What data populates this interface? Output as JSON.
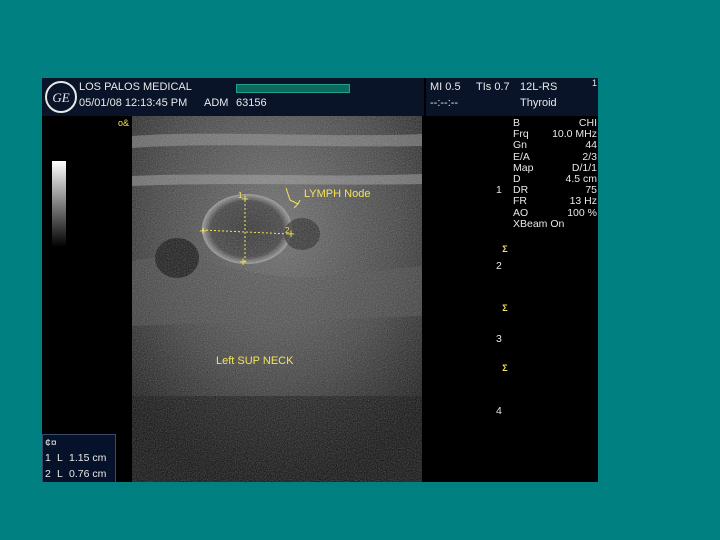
{
  "header": {
    "facility": "LOS PALOS MEDICAL",
    "datetime": "05/01/08 12:13:45 PM",
    "operator": "ADM",
    "patient_id": "63156",
    "mi": "MI 0.5",
    "tis": "TIs 0.7",
    "probe": "12L-RS",
    "preset": "Thyroid",
    "clock": "--:--:--",
    "frame_marker": "1",
    "logo_icon": "ge-logo-icon"
  },
  "annotations": {
    "lymph_node": "LYMPH Node",
    "region": "Left SUP NECK",
    "orientation_mark": "o&",
    "caliper1_label": "1",
    "caliper2_label": "2"
  },
  "params": [
    {
      "k": "B",
      "v": "CHI"
    },
    {
      "k": "Frq",
      "v": "10.0 MHz"
    },
    {
      "k": "Gn",
      "v": "44"
    },
    {
      "k": "E/A",
      "v": "2/3"
    },
    {
      "k": "Map",
      "v": "D/1/1"
    },
    {
      "k": "D",
      "v": "4.5 cm"
    },
    {
      "k": "DR",
      "v": "75"
    },
    {
      "k": "FR",
      "v": "13 Hz"
    },
    {
      "k": "AO",
      "v": "100 %"
    },
    {
      "k": "XBeam On",
      "v": ""
    }
  ],
  "depth_scale": [
    "1",
    "2",
    "3",
    "4"
  ],
  "measurements": {
    "header": "¢¤",
    "m1": {
      "idx": "1",
      "label": "L",
      "value": "1.15 cm"
    },
    "m2": {
      "idx": "2",
      "label": "L",
      "value": "0.76 cm"
    }
  },
  "colors": {
    "background": "#008080",
    "annotation": "#f2e35a",
    "screen": "#000000"
  }
}
